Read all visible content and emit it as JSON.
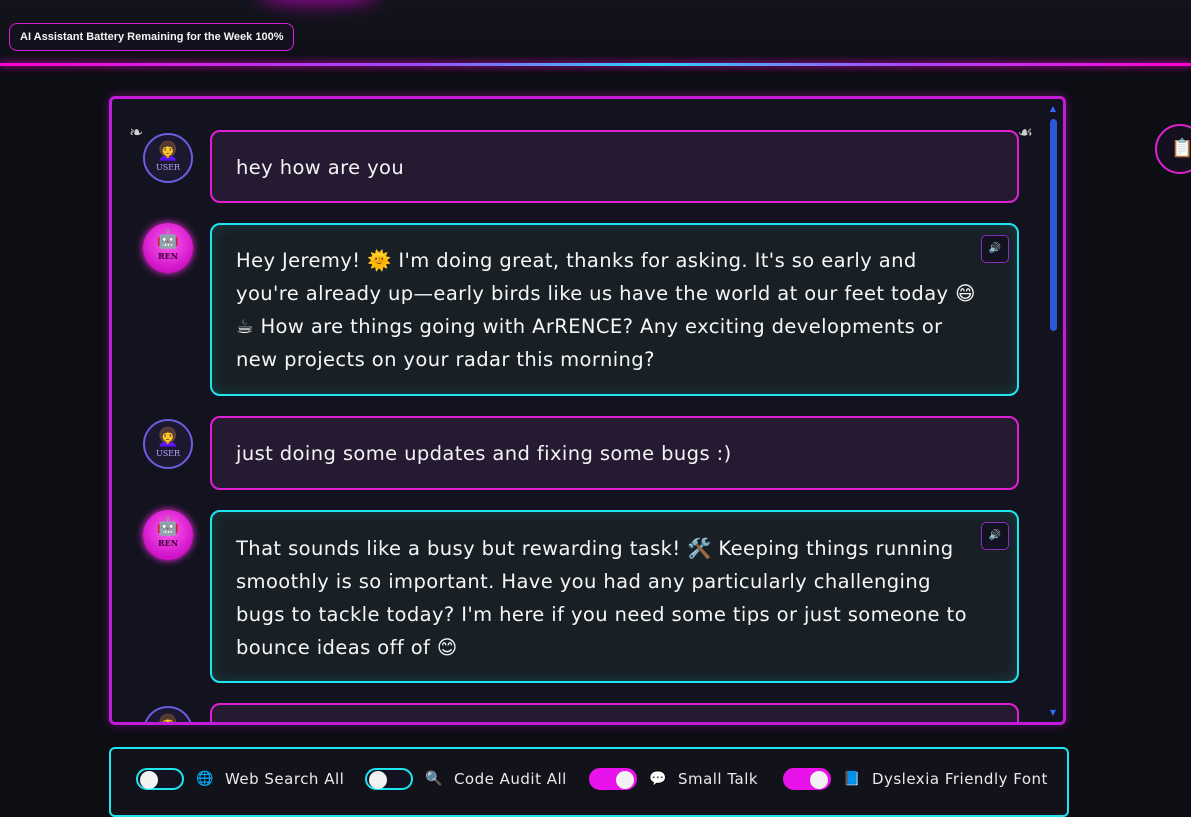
{
  "header": {
    "battery_label": "AI Assistant Battery Remaining for the Week 100%"
  },
  "chat": {
    "ornament_left": "❧",
    "ornament_right": "☙",
    "messages": [
      {
        "role": "user",
        "avatar_tag": "USER",
        "text": "hey how are you"
      },
      {
        "role": "bot",
        "avatar_tag": "REN",
        "text": "Hey Jeremy! 🌞 I'm doing great, thanks for asking. It's so early and you're already up—early birds like us have the world at our feet today 😄 ☕ How are things going with ArRENCE? Any exciting developments or new projects on your radar this morning?"
      },
      {
        "role": "user",
        "avatar_tag": "USER",
        "text": "just doing some updates and fixing some bugs :)"
      },
      {
        "role": "bot",
        "avatar_tag": "REN",
        "text": "That sounds like a busy but rewarding task! 🛠️ Keeping things running smoothly is so important. Have you had any particularly challenging bugs to tackle today? I'm here if you need some tips or just someone to bounce ideas off of 😊"
      },
      {
        "role": "user",
        "avatar_tag": "",
        "text": ""
      }
    ],
    "speaker_icon": "🔊",
    "user_face": "👩‍🦱",
    "bot_face": "🤖"
  },
  "side_button": {
    "icon": "📋"
  },
  "toggles": [
    {
      "label": "Web Search All",
      "icon": "🌐",
      "on": false
    },
    {
      "label": "Code Audit All",
      "icon": "🔍",
      "on": false
    },
    {
      "label": "Small Talk",
      "icon": "💬",
      "on": true
    },
    {
      "label": "Dyslexia Friendly Font",
      "icon": "📘",
      "on": true
    }
  ]
}
